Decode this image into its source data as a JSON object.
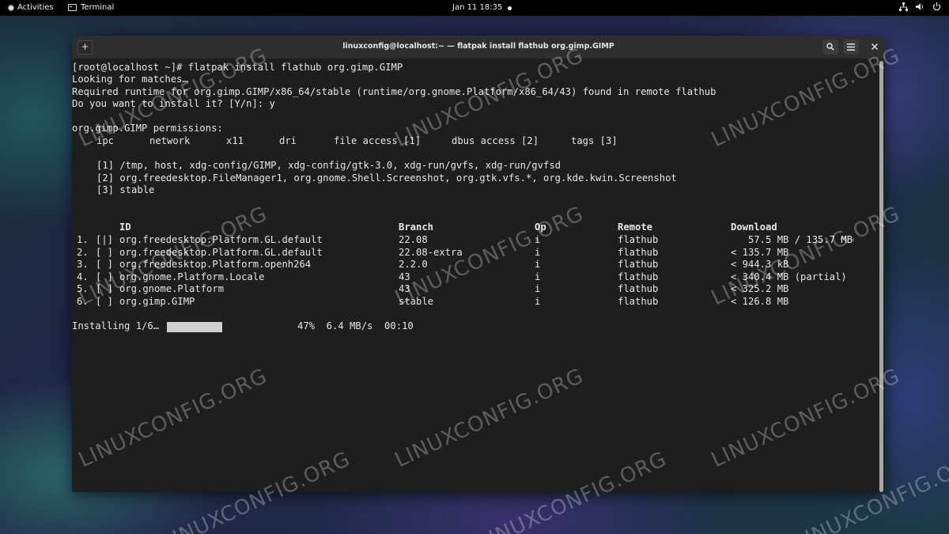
{
  "topbar": {
    "activities": "Activities",
    "app_name": "Terminal",
    "clock": "Jan 11  18:35"
  },
  "window": {
    "title": "linuxconfig@localhost:~ — flatpak install flathub org.gimp.GIMP",
    "new_tab_icon": "+"
  },
  "terminal": {
    "prompt_line": "[root@localhost ~]# flatpak install flathub org.gimp.GIMP",
    "looking": "Looking for matches…",
    "runtime_line": "Required runtime for org.gimp.GIMP/x86_64/stable (runtime/org.gnome.Platform/x86_64/43) found in remote flathub",
    "question": "Do you want to install it? [Y/n]: y",
    "permissions_title": "org.gimp.GIMP permissions:",
    "permissions": [
      "ipc",
      "network",
      "x11",
      "dri",
      "file access [1]",
      "dbus access [2]",
      "tags [3]"
    ],
    "perm_notes": [
      "[1] /tmp, host, xdg-config/GIMP, xdg-config/gtk-3.0, xdg-run/gvfs, xdg-run/gvfsd",
      "[2] org.freedesktop.FileManager1, org.gnome.Shell.Screenshot, org.gtk.vfs.*, org.kde.kwin.Screenshot",
      "[3] stable"
    ],
    "table_headers": {
      "id": "ID",
      "branch": "Branch",
      "op": "Op",
      "remote": "Remote",
      "download": "Download"
    },
    "rows": [
      {
        "num": "1.",
        "status": "[|]",
        "id": "org.freedesktop.Platform.GL.default",
        "branch": "22.08",
        "op": "i",
        "remote": "flathub",
        "download": "   57.5 MB / 135.7 MB"
      },
      {
        "num": "2.",
        "status": "[ ]",
        "id": "org.freedesktop.Platform.GL.default",
        "branch": "22.08-extra",
        "op": "i",
        "remote": "flathub",
        "download": "< 135.7 MB"
      },
      {
        "num": "3.",
        "status": "[ ]",
        "id": "org.freedesktop.Platform.openh264",
        "branch": "2.2.0",
        "op": "i",
        "remote": "flathub",
        "download": "< 944.3 kB"
      },
      {
        "num": "4.",
        "status": "[ ]",
        "id": "org.gnome.Platform.Locale",
        "branch": "43",
        "op": "i",
        "remote": "flathub",
        "download": "< 340.4 MB (partial)"
      },
      {
        "num": "5.",
        "status": "[ ]",
        "id": "org.gnome.Platform",
        "branch": "43",
        "op": "i",
        "remote": "flathub",
        "download": "< 325.2 MB"
      },
      {
        "num": "6.",
        "status": "[ ]",
        "id": "org.gimp.GIMP",
        "branch": "stable",
        "op": "i",
        "remote": "flathub",
        "download": "< 126.8 MB"
      }
    ],
    "installing_label": "Installing 1/6…",
    "progress_fraction": 0.47,
    "progress_text": "47%  6.4 MB/s  00:10"
  },
  "watermark": "LINUXCONFIG.ORG"
}
